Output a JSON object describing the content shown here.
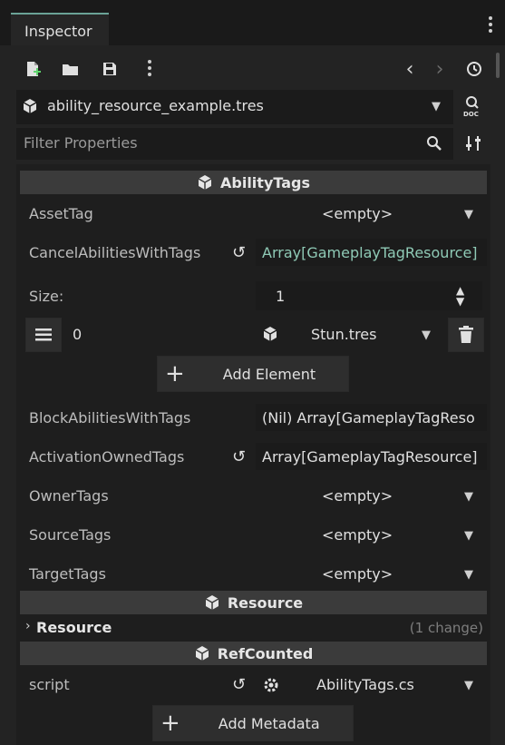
{
  "tab": {
    "label": "Inspector"
  },
  "resource": {
    "name": "ability_resource_example.tres"
  },
  "filter": {
    "placeholder": "Filter Properties"
  },
  "sections": {
    "ability_tags": "AbilityTags",
    "resource": "Resource",
    "refcounted": "RefCounted"
  },
  "props": {
    "asset_tag": {
      "label": "AssetTag",
      "value": "<empty>"
    },
    "cancel": {
      "label": "CancelAbilitiesWithTags",
      "value": "Array[GameplayTagResource]"
    },
    "size": {
      "label": "Size:",
      "value": "1"
    },
    "element": {
      "index": "0",
      "value": "Stun.tres"
    },
    "add_element": "Add Element",
    "block": {
      "label": "BlockAbilitiesWithTags",
      "value": "(Nil) Array[GameplayTagReso"
    },
    "activation": {
      "label": "ActivationOwnedTags",
      "value": "Array[GameplayTagResource]"
    },
    "owner": {
      "label": "OwnerTags",
      "value": "<empty>"
    },
    "source": {
      "label": "SourceTags",
      "value": "<empty>"
    },
    "target": {
      "label": "TargetTags",
      "value": "<empty>"
    }
  },
  "resource_group": {
    "label": "Resource",
    "changes": "(1 change)"
  },
  "script": {
    "label": "script",
    "value": "AbilityTags.cs"
  },
  "add_metadata": "Add Metadata",
  "colors": {
    "accent": "#6ba396",
    "link": "#8fcab6",
    "section_bg": "#3b3b3b"
  }
}
